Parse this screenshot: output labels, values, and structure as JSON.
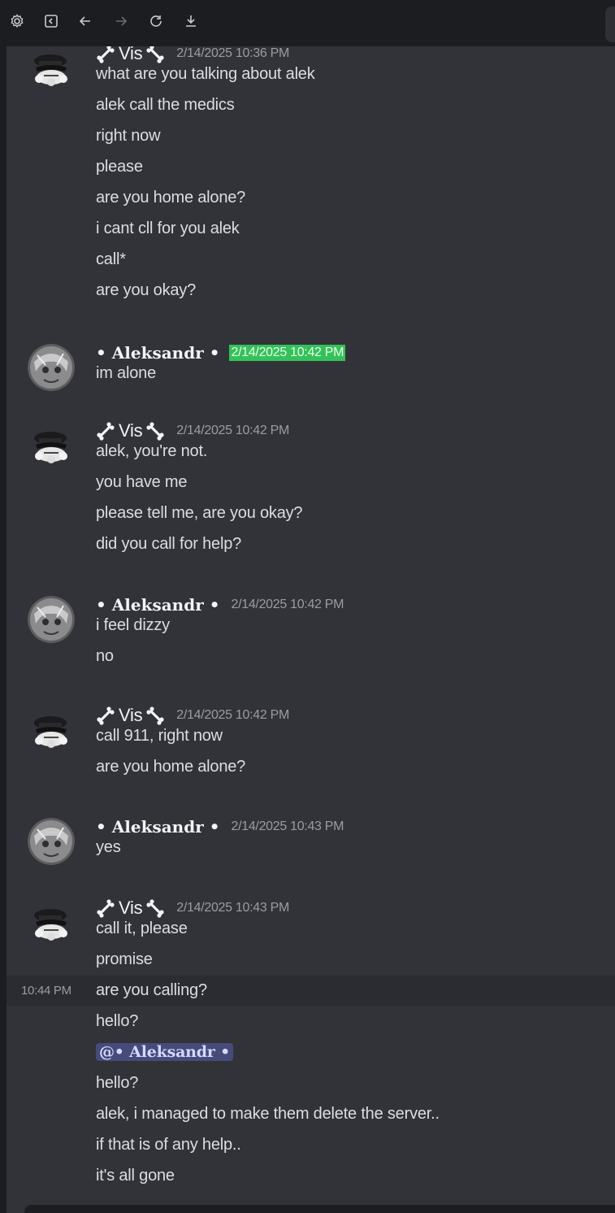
{
  "toolbar": {
    "icons": [
      "gear-icon",
      "sidebar-icon",
      "back-icon",
      "forward-icon",
      "reload-icon",
      "download-icon"
    ]
  },
  "colors": {
    "background": "#323339",
    "frame": "#1c1d21",
    "text": "#dcdde0",
    "timestamp": "#9a9ca3",
    "highlight": "#34c15a",
    "mention_bg": "#464b7a"
  },
  "messages": [
    {
      "author": "Vis",
      "timestamp": "2/14/2025 10:36 PM",
      "lines": [
        "what are you talking about alek",
        "alek call the medics",
        "right now",
        "please",
        "are you home alone?",
        "i cant cll for you alek",
        "call*",
        "are you okay?"
      ]
    },
    {
      "author": "• Aleksandr •",
      "timestamp": "2/14/2025 10:42 PM",
      "lines": [
        "im alone"
      ]
    },
    {
      "author": "Vis",
      "timestamp": "2/14/2025 10:42 PM",
      "lines": [
        "alek, you're not.",
        "you have me",
        "please tell me, are you okay?",
        "did you call for help?"
      ]
    },
    {
      "author": "• Aleksandr •",
      "timestamp": "2/14/2025 10:42 PM",
      "lines": [
        "i feel dizzy",
        "no"
      ]
    },
    {
      "author": "Vis",
      "timestamp": "2/14/2025 10:42 PM",
      "lines": [
        "call 911, right now",
        "are you home alone?"
      ]
    },
    {
      "author": "• Aleksandr •",
      "timestamp": "2/14/2025 10:43 PM",
      "lines": [
        "yes"
      ]
    },
    {
      "author": "Vis",
      "timestamp": "2/14/2025 10:43 PM",
      "lines": [
        "call it, please",
        "promise",
        "are you calling?",
        "hello?",
        "@• Aleksandr •",
        "hello?",
        "alek, i managed to make them delete the server..",
        "if that is of any help..",
        "it's all gone"
      ],
      "hover_time": "10:44 PM"
    }
  ]
}
